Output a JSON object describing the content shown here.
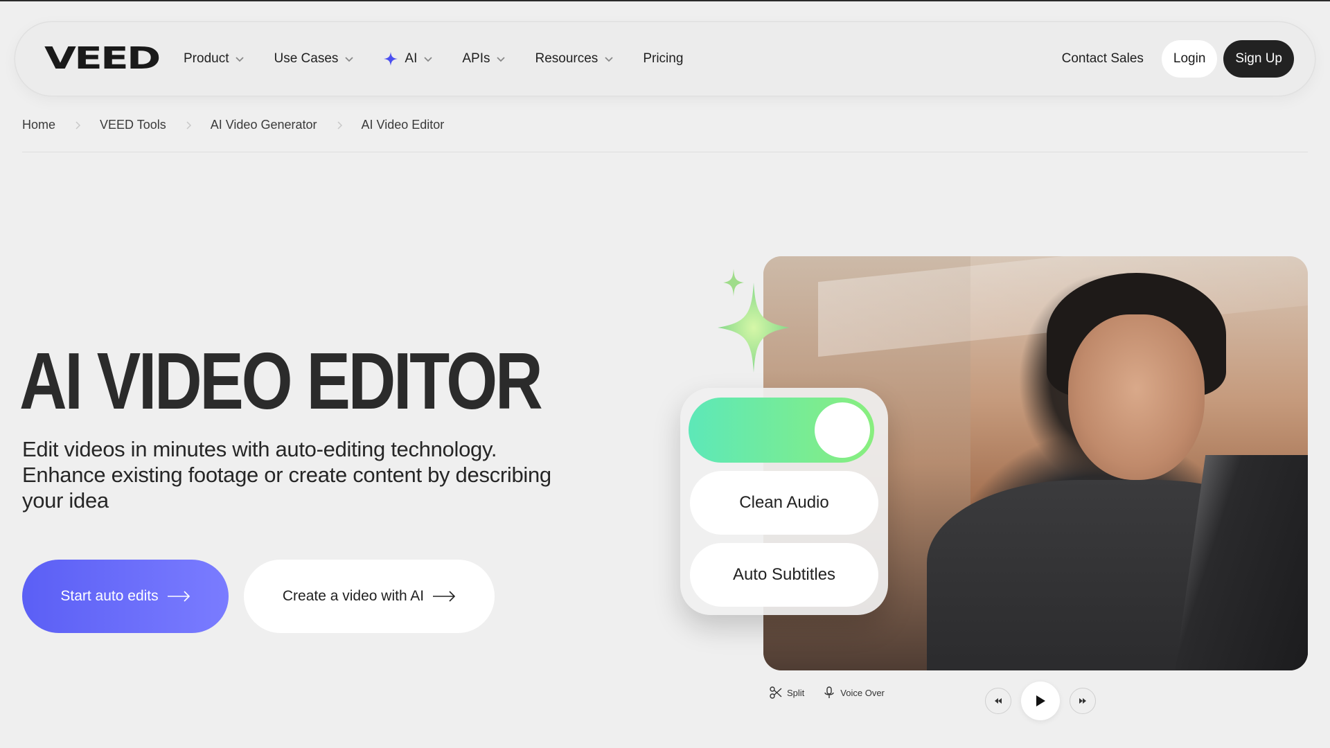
{
  "brand": {
    "logo_text": "VEED"
  },
  "nav": {
    "items": [
      {
        "label": "Product",
        "has_dropdown": true,
        "icon": ""
      },
      {
        "label": "Use Cases",
        "has_dropdown": true,
        "icon": ""
      },
      {
        "label": "AI",
        "has_dropdown": true,
        "icon": "sparkle-icon"
      },
      {
        "label": "APIs",
        "has_dropdown": true,
        "icon": ""
      },
      {
        "label": "Resources",
        "has_dropdown": true,
        "icon": ""
      },
      {
        "label": "Pricing",
        "has_dropdown": false,
        "icon": ""
      }
    ],
    "contact": "Contact Sales",
    "login": "Login",
    "signup": "Sign Up"
  },
  "breadcrumb": [
    "Home",
    "VEED Tools",
    "AI Video Generator",
    "AI Video Editor"
  ],
  "hero": {
    "title": "AI VIDEO EDITOR",
    "subtitle": "Edit videos in minutes with auto-editing technology. Enhance existing footage or create content by describing your idea",
    "primary_cta": "Start auto edits",
    "secondary_cta": "Create a video with AI"
  },
  "visual": {
    "toggle_state": "on",
    "options": [
      "Clean Audio",
      "Auto Subtitles"
    ],
    "controls": {
      "split": "Split",
      "voice_over": "Voice Over"
    }
  },
  "colors": {
    "accent": "#5b5ff5",
    "toggle_gradient_start": "#5de8b8",
    "toggle_gradient_end": "#89ee7e",
    "ai_sparkle": "#4b4ff0"
  }
}
